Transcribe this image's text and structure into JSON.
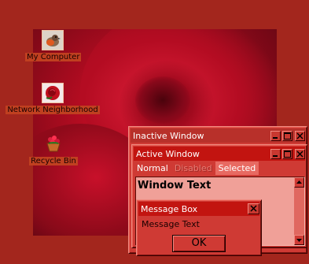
{
  "desktop": {
    "icons": [
      {
        "label": "My Computer"
      },
      {
        "label": "Network Neighborhood"
      },
      {
        "label": "Recycle Bin"
      }
    ]
  },
  "inactive_window": {
    "title": "Inactive Window"
  },
  "active_window": {
    "title": "Active Window",
    "menu": {
      "normal": "Normal",
      "disabled": "Disabled",
      "selected": "Selected"
    },
    "window_text": "Window Text"
  },
  "message_box": {
    "title": "Message Box",
    "text": "Message Text",
    "ok_label": "OK"
  },
  "colors": {
    "desktop": "#a3261d",
    "active_title": "#c21410",
    "inactive_title": "#b8302a",
    "window_face": "#cf3a34",
    "client": "#f0a098",
    "selected_menu": "#e86a62"
  },
  "icons": {
    "caption_minimize": "minimize-icon",
    "caption_maximize": "maximize-icon",
    "caption_close": "close-icon",
    "scroll_up": "arrow-up-icon",
    "scroll_down": "arrow-down-icon"
  }
}
